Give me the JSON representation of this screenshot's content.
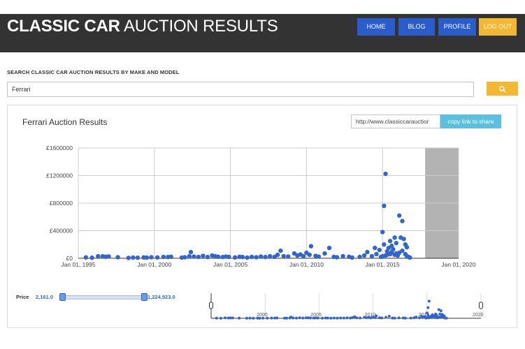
{
  "header": {
    "title_bold": "CLASSIC CAR",
    "title_rest": "AUCTION RESULTS",
    "nav": [
      "HOME",
      "BLOG",
      "PROFILE",
      "LOG OUT"
    ]
  },
  "search": {
    "label": "SEARCH CLASSIC CAR AUCTION RESULTS BY MAKE AND MODEL",
    "value": "Ferrari",
    "button_icon": "search-icon"
  },
  "chart_panel": {
    "title": "Ferrari Auction Results",
    "share_url": "http://www.classiccarauctior",
    "share_button": "copy link to share"
  },
  "price_filter": {
    "label": "Price",
    "min": "2,161.0",
    "max": "1,224,923.0"
  },
  "colors": {
    "header_bg": "#333333",
    "nav_blue": "#2a5ccc",
    "accent_yellow": "#f4b731",
    "share_blue": "#5bc0de",
    "point_blue": "#3366cc"
  },
  "chart_data": {
    "type": "scatter",
    "title": "Ferrari Auction Results",
    "xlabel": "",
    "ylabel": "",
    "x_ticks": [
      "Jan 01, 1995",
      "Jan 01, 2000",
      "Jan 01, 2005",
      "Jan 01, 2010",
      "Jan 01, 2015",
      "Jan 01, 2020"
    ],
    "y_ticks": [
      "£1600000",
      "£1200000",
      "£800000",
      "£400000",
      "£0"
    ],
    "xlim": [
      1995.0,
      2020.0
    ],
    "ylim": [
      0,
      1600000
    ],
    "shaded_range": [
      2017.8,
      2020.0
    ],
    "grid": true,
    "points": [
      [
        1995.5,
        12000
      ],
      [
        1995.9,
        8000
      ],
      [
        1996.3,
        30000
      ],
      [
        1996.6,
        28000
      ],
      [
        1996.8,
        22000
      ],
      [
        1997.0,
        26000
      ],
      [
        1997.6,
        15000
      ],
      [
        1998.3,
        5000
      ],
      [
        1998.6,
        10000
      ],
      [
        1998.9,
        8000
      ],
      [
        1999.3,
        12000
      ],
      [
        1999.5,
        9000
      ],
      [
        1999.8,
        15000
      ],
      [
        2000.2,
        12000
      ],
      [
        2000.6,
        20000
      ],
      [
        2000.9,
        18000
      ],
      [
        2001.1,
        22000
      ],
      [
        2001.8,
        10000
      ],
      [
        2002.0,
        15000
      ],
      [
        2002.3,
        28000
      ],
      [
        2002.4,
        90000
      ],
      [
        2002.6,
        25000
      ],
      [
        2002.9,
        20000
      ],
      [
        2003.2,
        35000
      ],
      [
        2003.5,
        18000
      ],
      [
        2003.8,
        40000
      ],
      [
        2004.0,
        30000
      ],
      [
        2004.2,
        22000
      ],
      [
        2004.5,
        18000
      ],
      [
        2004.7,
        25000
      ],
      [
        2004.9,
        20000
      ],
      [
        2005.3,
        12000
      ],
      [
        2005.6,
        22000
      ],
      [
        2005.8,
        18000
      ],
      [
        2006.1,
        10000
      ],
      [
        2006.4,
        20000
      ],
      [
        2006.7,
        15000
      ],
      [
        2007.0,
        25000
      ],
      [
        2007.3,
        18000
      ],
      [
        2007.6,
        30000
      ],
      [
        2007.9,
        20000
      ],
      [
        2008.1,
        50000
      ],
      [
        2008.3,
        110000
      ],
      [
        2008.5,
        30000
      ],
      [
        2008.8,
        25000
      ],
      [
        2009.2,
        70000
      ],
      [
        2009.4,
        40000
      ],
      [
        2009.6,
        55000
      ],
      [
        2009.8,
        30000
      ],
      [
        2010.0,
        80000
      ],
      [
        2010.2,
        50000
      ],
      [
        2010.3,
        175000
      ],
      [
        2010.6,
        35000
      ],
      [
        2010.8,
        25000
      ],
      [
        2011.2,
        70000
      ],
      [
        2011.5,
        150000
      ],
      [
        2011.8,
        20000
      ],
      [
        2012.0,
        15000
      ],
      [
        2012.4,
        30000
      ],
      [
        2012.8,
        22000
      ],
      [
        2013.0,
        10000
      ],
      [
        2013.5,
        20000
      ],
      [
        2013.8,
        40000
      ],
      [
        2014.0,
        90000
      ],
      [
        2014.3,
        30000
      ],
      [
        2014.5,
        150000
      ],
      [
        2014.6,
        60000
      ],
      [
        2014.8,
        120000
      ],
      [
        2015.0,
        380000
      ],
      [
        2015.1,
        200000
      ],
      [
        2015.2,
        1224923
      ],
      [
        2015.3,
        100000
      ],
      [
        2015.5,
        250000
      ],
      [
        2015.6,
        180000
      ],
      [
        2015.8,
        300000
      ],
      [
        2015.9,
        220000
      ],
      [
        2015.1,
        760000
      ],
      [
        2016.1,
        620000
      ],
      [
        2016.3,
        540000
      ],
      [
        2016.2,
        300000
      ],
      [
        2016.4,
        280000
      ],
      [
        2016.5,
        200000
      ],
      [
        2016.6,
        160000
      ],
      [
        2015.3,
        50000
      ],
      [
        2015.6,
        90000
      ],
      [
        2015.9,
        70000
      ],
      [
        2016.0,
        40000
      ],
      [
        2016.3,
        110000
      ],
      [
        2016.5,
        60000
      ],
      [
        2016.7,
        20000
      ],
      [
        2015.4,
        150000
      ],
      [
        2015.7,
        130000
      ],
      [
        2015.0,
        30000
      ],
      [
        2015.2,
        40000
      ],
      [
        2015.5,
        60000
      ],
      [
        2015.8,
        50000
      ],
      [
        2016.1,
        80000
      ],
      [
        2016.6,
        30000
      ],
      [
        2014.9,
        20000
      ],
      [
        2016.8,
        10000
      ]
    ]
  }
}
